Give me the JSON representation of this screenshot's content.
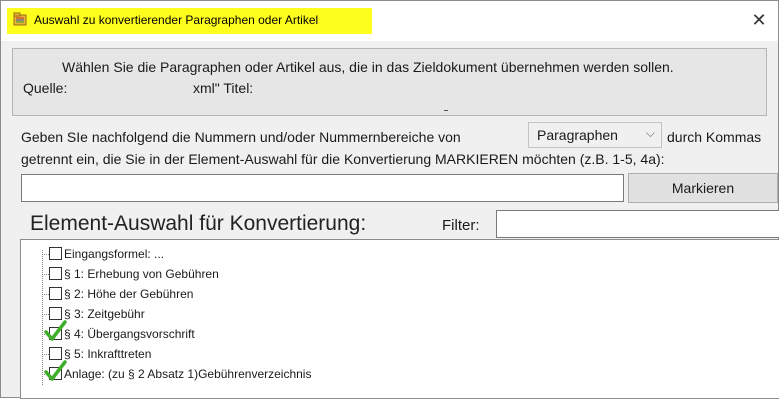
{
  "window": {
    "title": "Auswahl zu konvertierender Paragraphen oder Artikel",
    "close_symbol": "✕"
  },
  "info": {
    "instruction": "Wählen Sie die Paragraphen oder Artikel aus, die in das Zieldokument übernehmen werden sollen.",
    "source_label": "Quelle:",
    "xml_title_label": "xml\" Titel:"
  },
  "numbers": {
    "instruction_part1": "Geben SIe nachfolgend die Nummern und/oder Nummernbereiche von",
    "instruction_part2": "durch Kommas",
    "instruction_line2": "getrennt ein, die Sie in der Element-Auswahl für die Konvertierung MARKIEREN möchten (z.B. 1-5, 4a):",
    "type_select_value": "Paragraphen",
    "input_value": "",
    "mark_button_label": "Markieren"
  },
  "element_selection": {
    "heading": "Element-Auswahl für Konvertierung:",
    "filter_label": "Filter:",
    "filter_value": ""
  },
  "tree": {
    "items": [
      {
        "label": "Eingangsformel: ...",
        "checked": false
      },
      {
        "label": "§ 1: Erhebung von Gebühren",
        "checked": false
      },
      {
        "label": "§ 2: Höhe der Gebühren",
        "checked": false
      },
      {
        "label": "§ 3: Zeitgebühr",
        "checked": false
      },
      {
        "label": "§ 4: Übergangsvorschrift",
        "checked": true
      },
      {
        "label": "§ 5: Inkrafttreten",
        "checked": false
      },
      {
        "label": "Anlage: (zu § 2 Absatz 1)Gebührenverzeichnis",
        "checked": true
      }
    ]
  },
  "colors": {
    "title_highlight": "#ffff1e",
    "check_green": "#3fae2a"
  }
}
